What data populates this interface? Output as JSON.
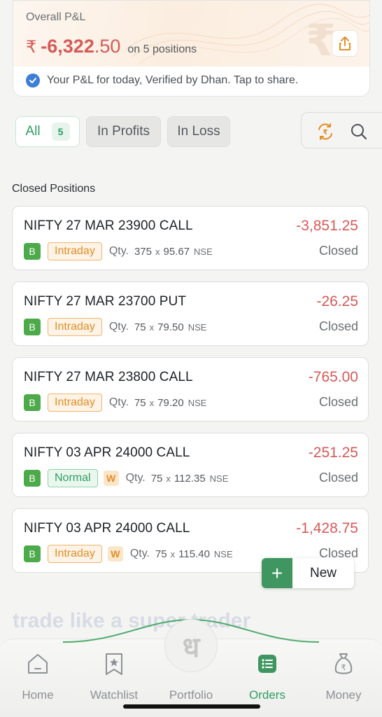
{
  "pnl_card": {
    "label": "Overall P&L",
    "currency": "₹",
    "value_int": "-6,322",
    "value_dec": ".50",
    "positions_text": "on 5 positions",
    "verified_text": "Your P&L for today, Verified by Dhan. Tap to share."
  },
  "filters": {
    "all_label": "All",
    "all_count": "5",
    "profits_label": "In Profits",
    "loss_label": "In Loss"
  },
  "section_title": "Closed Positions",
  "positions": [
    {
      "name": "NIFTY 27 MAR 23900 CALL",
      "pnl": "-3,851.25",
      "side": "B",
      "type": "Intraday",
      "weekly": "",
      "qty_label": "Qty.",
      "qty": "375",
      "price": "95.67",
      "exchange": "NSE",
      "status": "Closed"
    },
    {
      "name": "NIFTY 27 MAR 23700 PUT",
      "pnl": "-26.25",
      "side": "B",
      "type": "Intraday",
      "weekly": "",
      "qty_label": "Qty.",
      "qty": "75",
      "price": "79.50",
      "exchange": "NSE",
      "status": "Closed"
    },
    {
      "name": "NIFTY 27 MAR 23800 CALL",
      "pnl": "-765.00",
      "side": "B",
      "type": "Intraday",
      "weekly": "",
      "qty_label": "Qty.",
      "qty": "75",
      "price": "79.20",
      "exchange": "NSE",
      "status": "Closed"
    },
    {
      "name": "NIFTY 03 APR 24000 CALL",
      "pnl": "-251.25",
      "side": "B",
      "type": "Normal",
      "weekly": "W",
      "qty_label": "Qty.",
      "qty": "75",
      "price": "112.35",
      "exchange": "NSE",
      "status": "Closed"
    },
    {
      "name": "NIFTY 03 APR 24000 CALL",
      "pnl": "-1,428.75",
      "side": "B",
      "type": "Intraday",
      "weekly": "W",
      "qty_label": "Qty.",
      "qty": "75",
      "price": "115.40",
      "exchange": "NSE",
      "status": "Closed"
    }
  ],
  "new_button": {
    "plus": "+",
    "label": "New"
  },
  "promo_text": "trade like a super trader",
  "bottom_nav": {
    "home": "Home",
    "watchlist": "Watchlist",
    "portfolio": "Portfolio",
    "portfolio_glyph": "ध",
    "orders": "Orders",
    "money": "Money"
  },
  "colors": {
    "loss_red": "#d65a57",
    "accent_green": "#2e9e63",
    "intraday_orange": "#e58e26"
  },
  "icons": [
    "share-icon",
    "verified-check-icon",
    "rupee-swap-icon",
    "search-icon",
    "home-icon",
    "watchlist-star-icon",
    "orders-list-icon",
    "money-bag-icon"
  ]
}
